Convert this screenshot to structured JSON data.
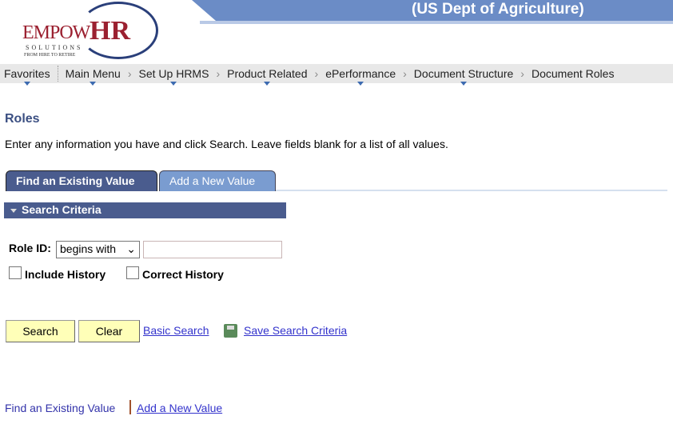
{
  "header": {
    "org": "(US Dept of Agriculture)",
    "logo": {
      "brand_a": "EMPOW",
      "brand_b": "HR",
      "solutions": "SOLUTIONS",
      "tagline": "FROM HIRE TO RETIRE"
    }
  },
  "nav": {
    "favorites": "Favorites",
    "breadcrumbs": [
      "Main Menu",
      "Set Up HRMS",
      "Product Related",
      "ePerformance",
      "Document Structure",
      "Document Roles"
    ]
  },
  "page": {
    "title": "Roles",
    "instructions": "Enter any information you have and click Search. Leave fields blank for a list of all values."
  },
  "tabs": {
    "find": "Find an Existing Value",
    "add": "Add a New Value"
  },
  "search": {
    "section": "Search Criteria",
    "role_label": "Role ID:",
    "operator": "begins with",
    "value": "",
    "include_history": "Include History",
    "correct_history": "Correct History"
  },
  "actions": {
    "search": "Search",
    "clear": "Clear",
    "basic": "Basic Search",
    "save": "Save Search Criteria"
  },
  "footer": {
    "find": "Find an Existing Value",
    "add": "Add a New Value"
  }
}
